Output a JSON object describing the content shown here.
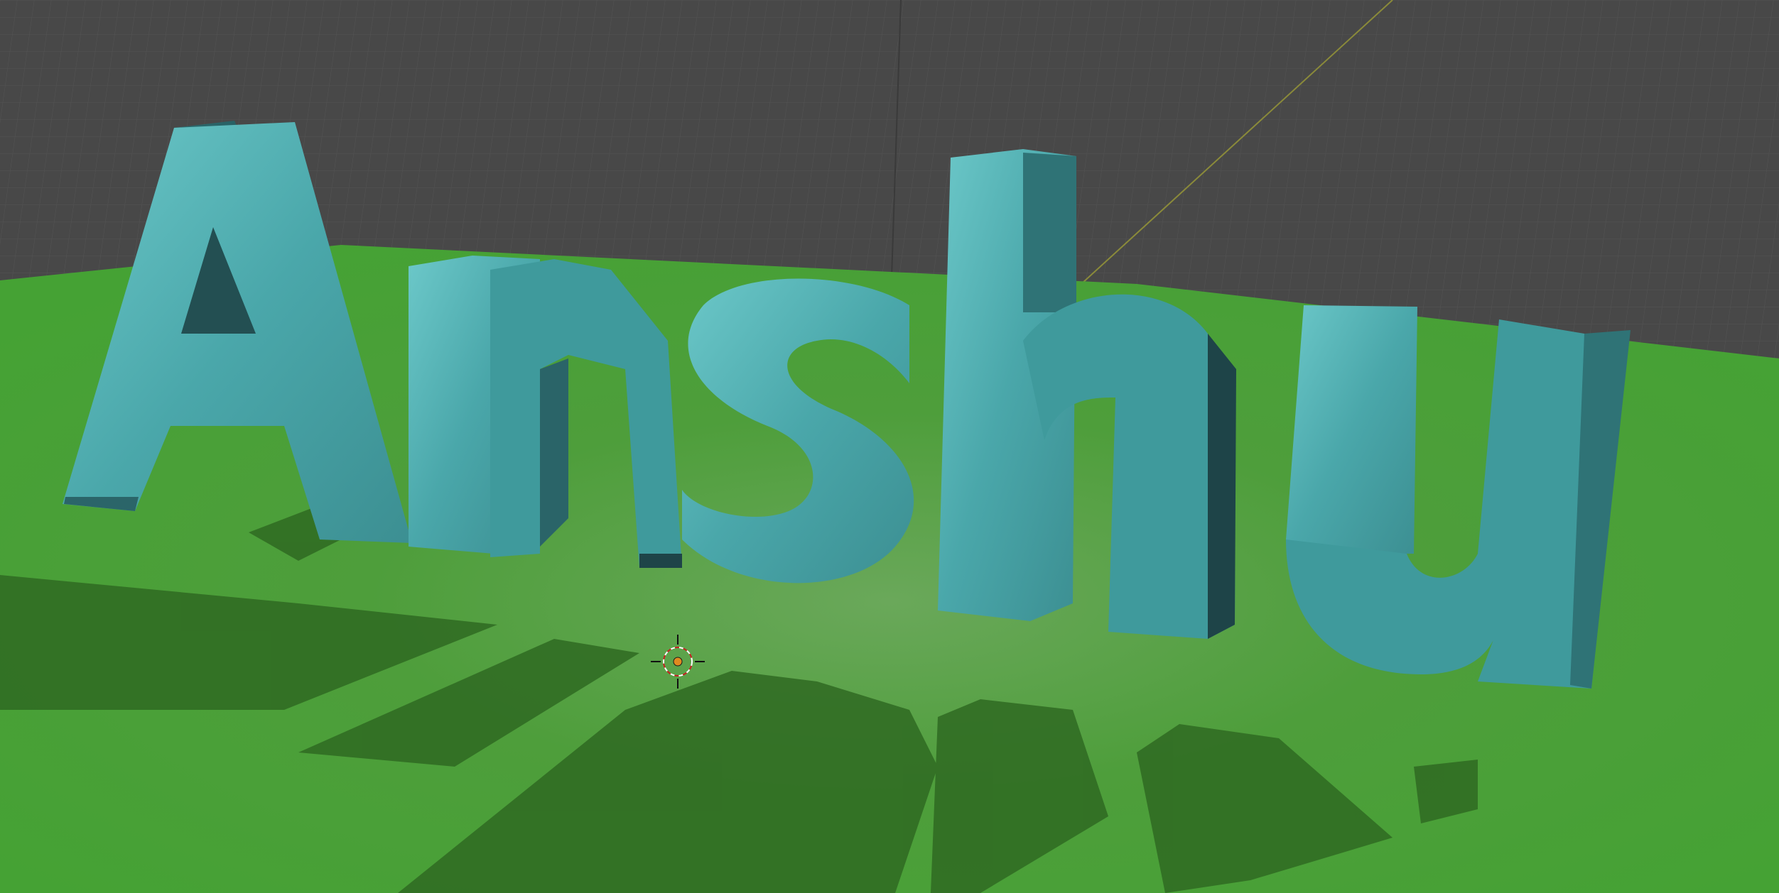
{
  "viewport": {
    "type": "3d-viewport",
    "shading": "solid",
    "colors": {
      "background": "#484848",
      "grid_line": "#545454",
      "ground": "#4b9c3a",
      "ground_dark": "#2f6a22",
      "mesh_face": "#4aa7aa",
      "mesh_light": "#66c3c4",
      "mesh_side": "#2a6468",
      "mesh_shadow": "#1e4448",
      "axis_y": "#8a8a3a",
      "cursor_fill": "#e08a20"
    }
  },
  "scene": {
    "text_object": {
      "body": "Anshu",
      "extruded": true,
      "bevel": true
    },
    "ground_plane": {
      "material": "green"
    },
    "cursor_3d": {
      "icon": "3d-cursor-icon"
    }
  }
}
